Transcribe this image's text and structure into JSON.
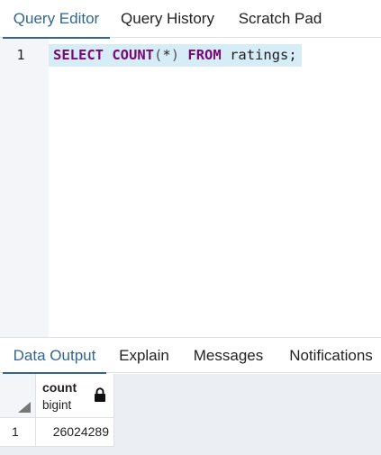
{
  "editor_tabs": [
    {
      "label": "Query Editor",
      "active": true
    },
    {
      "label": "Query History",
      "active": false
    },
    {
      "label": "Scratch Pad",
      "active": false
    }
  ],
  "editor": {
    "line_numbers": [
      "1"
    ],
    "code": {
      "select_kw": "SELECT",
      "count_kw": "COUNT",
      "paren_open": "(",
      "star": "*",
      "paren_close": ")",
      "from_kw": "FROM",
      "table": "ratings;"
    }
  },
  "output_tabs": [
    {
      "label": "Data Output",
      "active": true
    },
    {
      "label": "Explain",
      "active": false
    },
    {
      "label": "Messages",
      "active": false
    },
    {
      "label": "Notifications",
      "active": false
    }
  ],
  "grid": {
    "columns": [
      {
        "name": "count",
        "type": "bigint",
        "icon": "lock-icon"
      }
    ],
    "rows": [
      {
        "row_number": "1",
        "values": [
          "26024289"
        ]
      }
    ]
  },
  "colors": {
    "accent": "#326690",
    "keyword": "#7a0874",
    "line_highlight": "#d6ecf7",
    "gutter": "#f3f5f9",
    "grid_background": "#ebeef3"
  }
}
